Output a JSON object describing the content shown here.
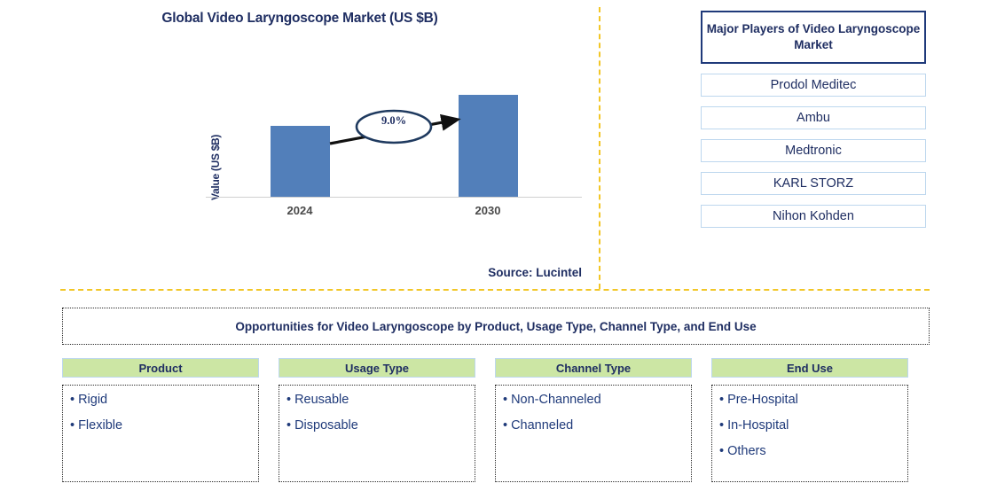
{
  "chart_data": {
    "type": "bar",
    "title": "Global Video Laryngoscope Market (US $B)",
    "ylabel": "Value (US $B)",
    "xlabel": "",
    "categories": [
      "2024",
      "2030"
    ],
    "values": [
      0.7,
      1.0
    ],
    "ylim": [
      0,
      1.15
    ],
    "grid": false,
    "legend": "none",
    "annotations": [
      {
        "text": "9.0%",
        "kind": "cagr-callout",
        "from": "2024",
        "to": "2030",
        "shape": "ellipse-with-arrow"
      }
    ],
    "source": "Source: Lucintel",
    "bar_color": "#527FBA",
    "axis_color": "#D0D0D0"
  },
  "chart": {
    "title": "Global Video Laryngoscope Market (US $B)",
    "y_axis_label": "Value (US $B)",
    "tick_2024": "2024",
    "tick_2030": "2030",
    "growth_label": "9.0%",
    "source": "Source: Lucintel"
  },
  "players": {
    "header": "Major Players of Video Laryngoscope Market",
    "items": [
      {
        "name": "Prodol Meditec"
      },
      {
        "name": "Ambu"
      },
      {
        "name": "Medtronic"
      },
      {
        "name": "KARL STORZ"
      },
      {
        "name": "Nihon Kohden"
      }
    ]
  },
  "opportunities": {
    "banner": "Opportunities for Video Laryngoscope by Product, Usage Type, Channel Type, and End Use",
    "columns": [
      {
        "header": "Product",
        "items": [
          "Rigid",
          "Flexible"
        ]
      },
      {
        "header": "Usage Type",
        "items": [
          "Reusable",
          "Disposable"
        ]
      },
      {
        "header": "Channel Type",
        "items": [
          "Non-Channeled",
          "Channeled"
        ]
      },
      {
        "header": "End Use",
        "items": [
          "Pre-Hospital",
          "In-Hospital",
          "Others"
        ]
      }
    ]
  },
  "colors": {
    "navy": "#1F2E62",
    "bar_blue": "#527FBA",
    "divider_gold": "#F2C626",
    "header_green": "#CCE6A4",
    "box_border_blue": "#BDD7EE"
  },
  "icons": {
    "bullet": "•"
  }
}
